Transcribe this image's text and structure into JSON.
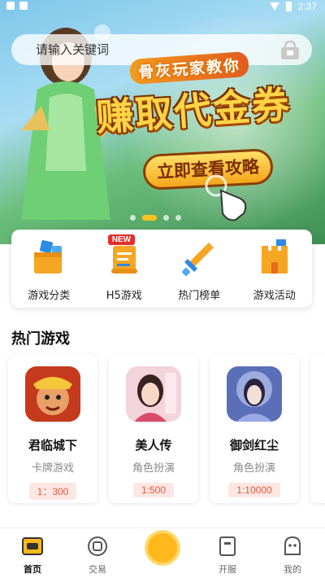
{
  "status_bar": {
    "time": "2:37"
  },
  "search": {
    "placeholder": "请输入关键词"
  },
  "banner": {
    "subtitle": "骨灰玩家教你",
    "title": "赚取代金券",
    "button_label": "立即查看攻略",
    "page_count": 4,
    "active_page": 2
  },
  "categories": [
    {
      "label": "游戏分类",
      "icon": "game-category-icon"
    },
    {
      "label": "H5游戏",
      "icon": "h5-scroll-icon",
      "badge": "NEW"
    },
    {
      "label": "热门榜单",
      "icon": "sword-icon"
    },
    {
      "label": "游戏活动",
      "icon": "castle-icon"
    }
  ],
  "hot_games": {
    "title": "热门游戏",
    "items": [
      {
        "name": "君临城下",
        "type": "卡牌游戏",
        "ratio": "1：300"
      },
      {
        "name": "美人传",
        "type": "角色扮演",
        "ratio": "1:500"
      },
      {
        "name": "御剑红尘",
        "type": "角色扮演",
        "ratio": "1:10000"
      }
    ]
  },
  "bottom_nav": {
    "items": [
      {
        "label": "首页",
        "icon": "home-icon",
        "active": true
      },
      {
        "label": "交易",
        "icon": "trade-icon",
        "active": false
      },
      {
        "label": "",
        "icon": "center-coin-icon",
        "active": false
      },
      {
        "label": "开服",
        "icon": "server-open-icon",
        "active": false
      },
      {
        "label": "我的",
        "icon": "profile-icon",
        "active": false
      }
    ]
  },
  "colors": {
    "accent": "#ffb81c",
    "price_bg": "#fde7e3",
    "price_text": "#e05a3c"
  }
}
